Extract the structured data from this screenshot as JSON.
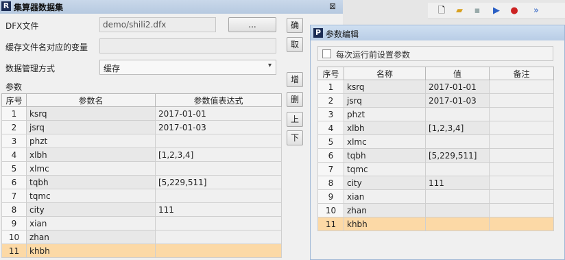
{
  "main_window": {
    "title": "集算器数据集",
    "close_glyph": "⊠",
    "dfx_label": "DFX文件",
    "dfx_value": "demo/shili2.dfx",
    "browse_label": "...",
    "cache_var_label": "缓存文件名对应的变量",
    "cache_var_value": "",
    "data_mgmt_label": "数据管理方式",
    "data_mgmt_value": "缓存",
    "params_label": "参数",
    "ok_label": "确定(O)",
    "cancel_label": "取",
    "add_label": "增",
    "delete_label": "删",
    "up_label": "上",
    "down_label": "下",
    "columns": [
      "序号",
      "参数名",
      "参数值表达式"
    ],
    "rows": [
      {
        "idx": "1",
        "name": "ksrq",
        "expr": "2017-01-01"
      },
      {
        "idx": "2",
        "name": "jsrq",
        "expr": "2017-01-03"
      },
      {
        "idx": "3",
        "name": "phzt",
        "expr": ""
      },
      {
        "idx": "4",
        "name": "xlbh",
        "expr": "[1,2,3,4]"
      },
      {
        "idx": "5",
        "name": "xlmc",
        "expr": ""
      },
      {
        "idx": "6",
        "name": "tqbh",
        "expr": "[5,229,511]"
      },
      {
        "idx": "7",
        "name": "tqmc",
        "expr": ""
      },
      {
        "idx": "8",
        "name": "city",
        "expr": "111"
      },
      {
        "idx": "9",
        "name": "xian",
        "expr": ""
      },
      {
        "idx": "10",
        "name": "zhan",
        "expr": ""
      },
      {
        "idx": "11",
        "name": "khbh",
        "expr": ""
      }
    ]
  },
  "param_dialog": {
    "title": "参数编辑",
    "checkbox_label": "每次运行前设置参数",
    "columns": [
      "序号",
      "名称",
      "值",
      "备注"
    ],
    "rows": [
      {
        "idx": "1",
        "name": "ksrq",
        "value": "2017-01-01",
        "note": ""
      },
      {
        "idx": "2",
        "name": "jsrq",
        "value": "2017-01-03",
        "note": ""
      },
      {
        "idx": "3",
        "name": "phzt",
        "value": "",
        "note": ""
      },
      {
        "idx": "4",
        "name": "xlbh",
        "value": "[1,2,3,4]",
        "note": ""
      },
      {
        "idx": "5",
        "name": "xlmc",
        "value": "",
        "note": ""
      },
      {
        "idx": "6",
        "name": "tqbh",
        "value": "[5,229,511]",
        "note": ""
      },
      {
        "idx": "7",
        "name": "tqmc",
        "value": "",
        "note": ""
      },
      {
        "idx": "8",
        "name": "city",
        "value": "111",
        "note": ""
      },
      {
        "idx": "9",
        "name": "xian",
        "value": "",
        "note": ""
      },
      {
        "idx": "10",
        "name": "zhan",
        "value": "",
        "note": ""
      },
      {
        "idx": "11",
        "name": "khbh",
        "value": "",
        "note": ""
      }
    ],
    "selected_row": "11"
  },
  "toolbar": {
    "icons": [
      "new-file-icon",
      "open-folder-icon",
      "save-icon",
      "run-icon",
      "debug-icon",
      "step-icon"
    ]
  },
  "colors": {
    "selected_row": "#fcd9a6",
    "title_bar": "#c9d8ea"
  }
}
